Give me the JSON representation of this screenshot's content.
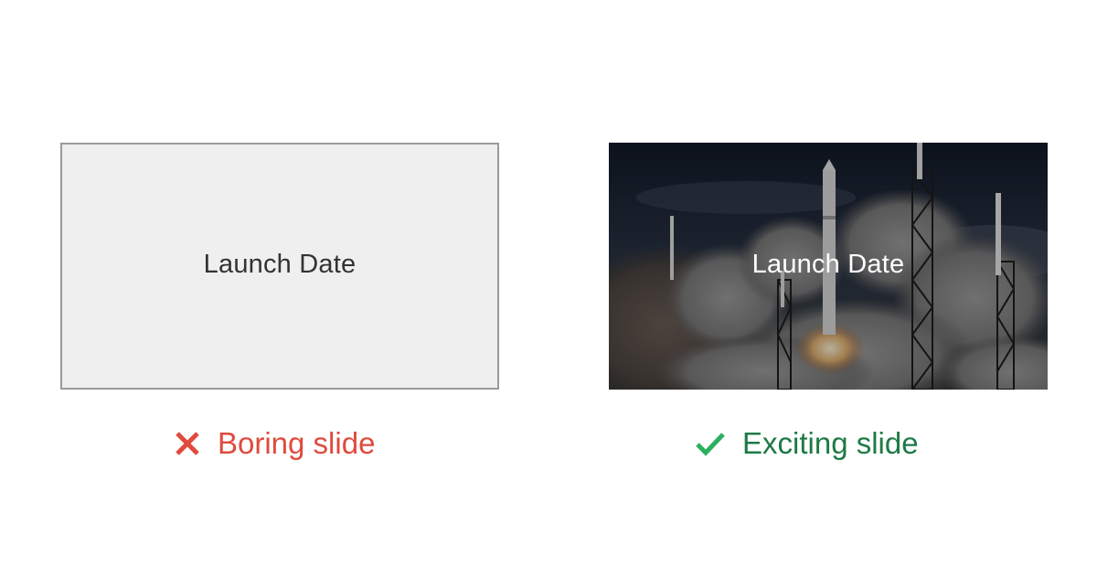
{
  "slides": {
    "boring": {
      "text": "Launch Date",
      "caption": "Boring slide",
      "icon": "cross-icon",
      "caption_color": "#e04a3d"
    },
    "exciting": {
      "text": "Launch Date",
      "caption": "Exciting slide",
      "icon": "checkmark-icon",
      "caption_color": "#1e7a45",
      "background_image": "rocket-launch-photo"
    }
  },
  "colors": {
    "boring_bg": "#efefef",
    "boring_border": "#9a9a9a",
    "cross": "#e04a3d",
    "check": "#2bb160"
  }
}
